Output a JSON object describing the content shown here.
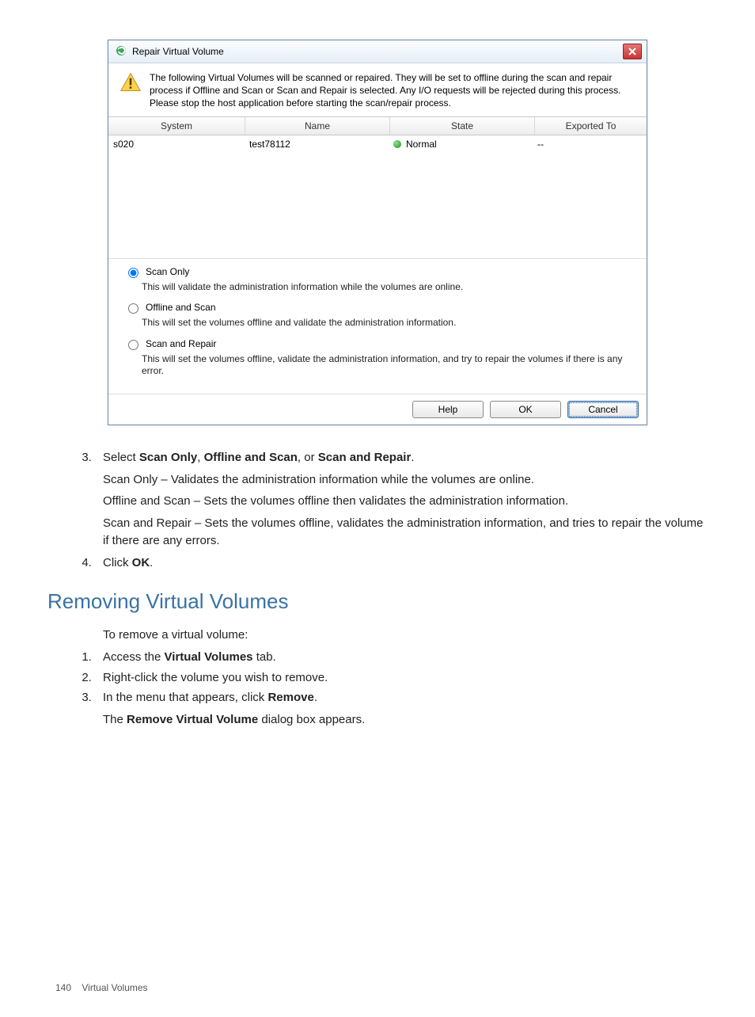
{
  "dialog": {
    "title": "Repair Virtual Volume",
    "warning": "The following Virtual Volumes will be scanned or repaired. They will be set to offline during the scan and repair process if Offline and Scan or Scan and Repair is selected. Any I/O requests will be rejected during this process. Please stop the host application before starting the scan/repair process.",
    "columns": {
      "system": "System",
      "name": "Name",
      "state": "State",
      "exported": "Exported To"
    },
    "row": {
      "system": "s020",
      "name": "test78112",
      "state": "Normal",
      "exported": "--"
    },
    "options": {
      "scan_only": {
        "label": "Scan Only",
        "desc": "This will validate the administration information while the volumes are online."
      },
      "offline_scan": {
        "label": "Offline and Scan",
        "desc": "This will set the volumes offline and validate the administration information."
      },
      "scan_repair": {
        "label": "Scan and Repair",
        "desc": "This will set the volumes offline, validate the administration information, and try to repair the volumes if there is any error."
      }
    },
    "buttons": {
      "help": "Help",
      "ok": "OK",
      "cancel": "Cancel"
    }
  },
  "doc": {
    "step3_prefix": "Select ",
    "step3_b1": "Scan Only",
    "step3_mid1": ", ",
    "step3_b2": "Offline and Scan",
    "step3_mid2": ", or ",
    "step3_b3": "Scan and Repair",
    "step3_suffix": ".",
    "step3_l1": "Scan Only – Validates the administration information while the volumes are online.",
    "step3_l2": "Offline and Scan – Sets the volumes offline then validates the administration information.",
    "step3_l3": "Scan and Repair – Sets the volumes offline, validates the administration information, and tries to repair the volume if there are any errors.",
    "step4_prefix": "Click ",
    "step4_b": "OK",
    "step4_suffix": ".",
    "heading": "Removing Virtual Volumes",
    "intro": "To remove a virtual volume:",
    "r1_prefix": "Access the ",
    "r1_b": "Virtual Volumes",
    "r1_suffix": " tab.",
    "r2": "Right-click the volume you wish to remove.",
    "r3_prefix": "In the menu that appears, click ",
    "r3_b": "Remove",
    "r3_suffix": ".",
    "r3_body_prefix": "The ",
    "r3_body_b": "Remove Virtual Volume",
    "r3_body_suffix": " dialog box appears."
  },
  "footer": {
    "page": "140",
    "section": "Virtual Volumes"
  }
}
